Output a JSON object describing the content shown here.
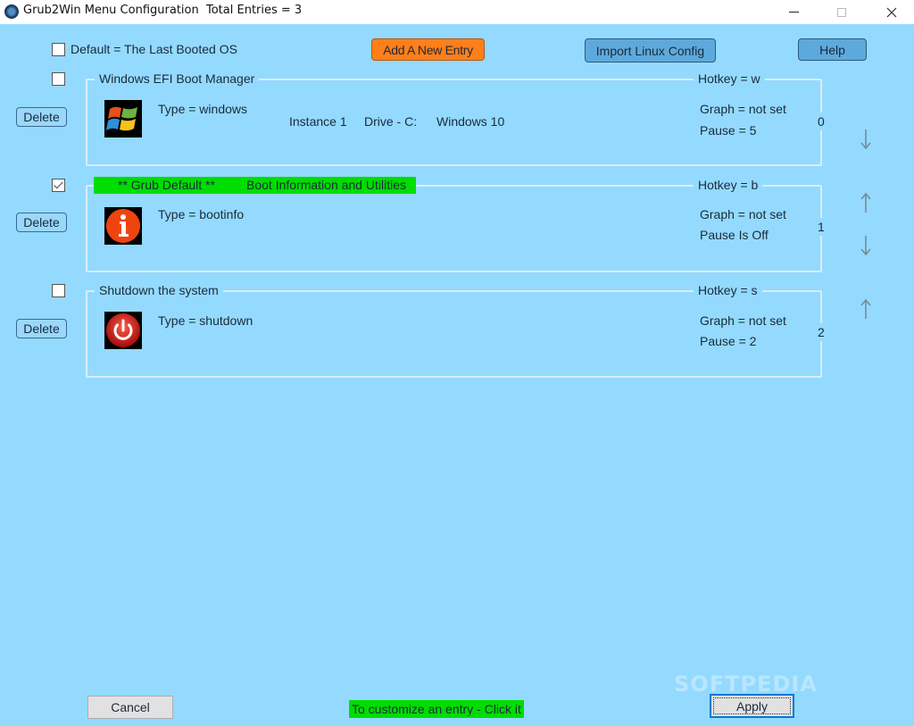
{
  "window": {
    "title": "Grub2Win Menu Configuration",
    "total_entries": "Total Entries = 3",
    "minimize_icon": "minimize-icon",
    "maximize_icon": "maximize-icon",
    "close_icon": "close-icon"
  },
  "toolbar": {
    "default_last_booted_label": "Default = The Last Booted OS",
    "default_last_booted_checked": false,
    "add_entry_label": "Add A New Entry",
    "import_label": "Import Linux Config",
    "help_label": "Help"
  },
  "entries": [
    {
      "title": "Windows EFI Boot Manager",
      "checked": false,
      "is_default": false,
      "hotkey": "Hotkey = w",
      "type": "Type = windows",
      "icon": "windows-logo-icon",
      "instance": "Instance 1",
      "drive": "Drive - C:",
      "os": "Windows 10",
      "graph": "Graph = not set",
      "pause": "Pause = 5",
      "index": "0",
      "delete_label": "Delete",
      "move_up": false,
      "move_down": true
    },
    {
      "title": "** Grub Default **",
      "title_b": "Boot Information and Utilities",
      "checked": true,
      "is_default": true,
      "hotkey": "Hotkey = b",
      "type": "Type = bootinfo",
      "icon": "info-icon",
      "graph": "Graph = not set",
      "pause": "Pause Is Off",
      "index": "1",
      "delete_label": "Delete",
      "move_up": true,
      "move_down": true
    },
    {
      "title": "Shutdown the system",
      "checked": false,
      "is_default": false,
      "hotkey": "Hotkey = s",
      "type": "Type = shutdown",
      "icon": "power-icon",
      "graph": "Graph = not set",
      "pause": "Pause = 2",
      "index": "2",
      "delete_label": "Delete",
      "move_up": true,
      "move_down": false
    }
  ],
  "footer": {
    "cancel_label": "Cancel",
    "hint": "To customize an entry - Click it",
    "apply_label": "Apply",
    "watermark": "SOFTPEDIA"
  },
  "colors": {
    "background": "#94daff",
    "add_button": "#ff7f1a",
    "blue_button": "#5ea9dc",
    "default_highlight": "#00dd00"
  }
}
